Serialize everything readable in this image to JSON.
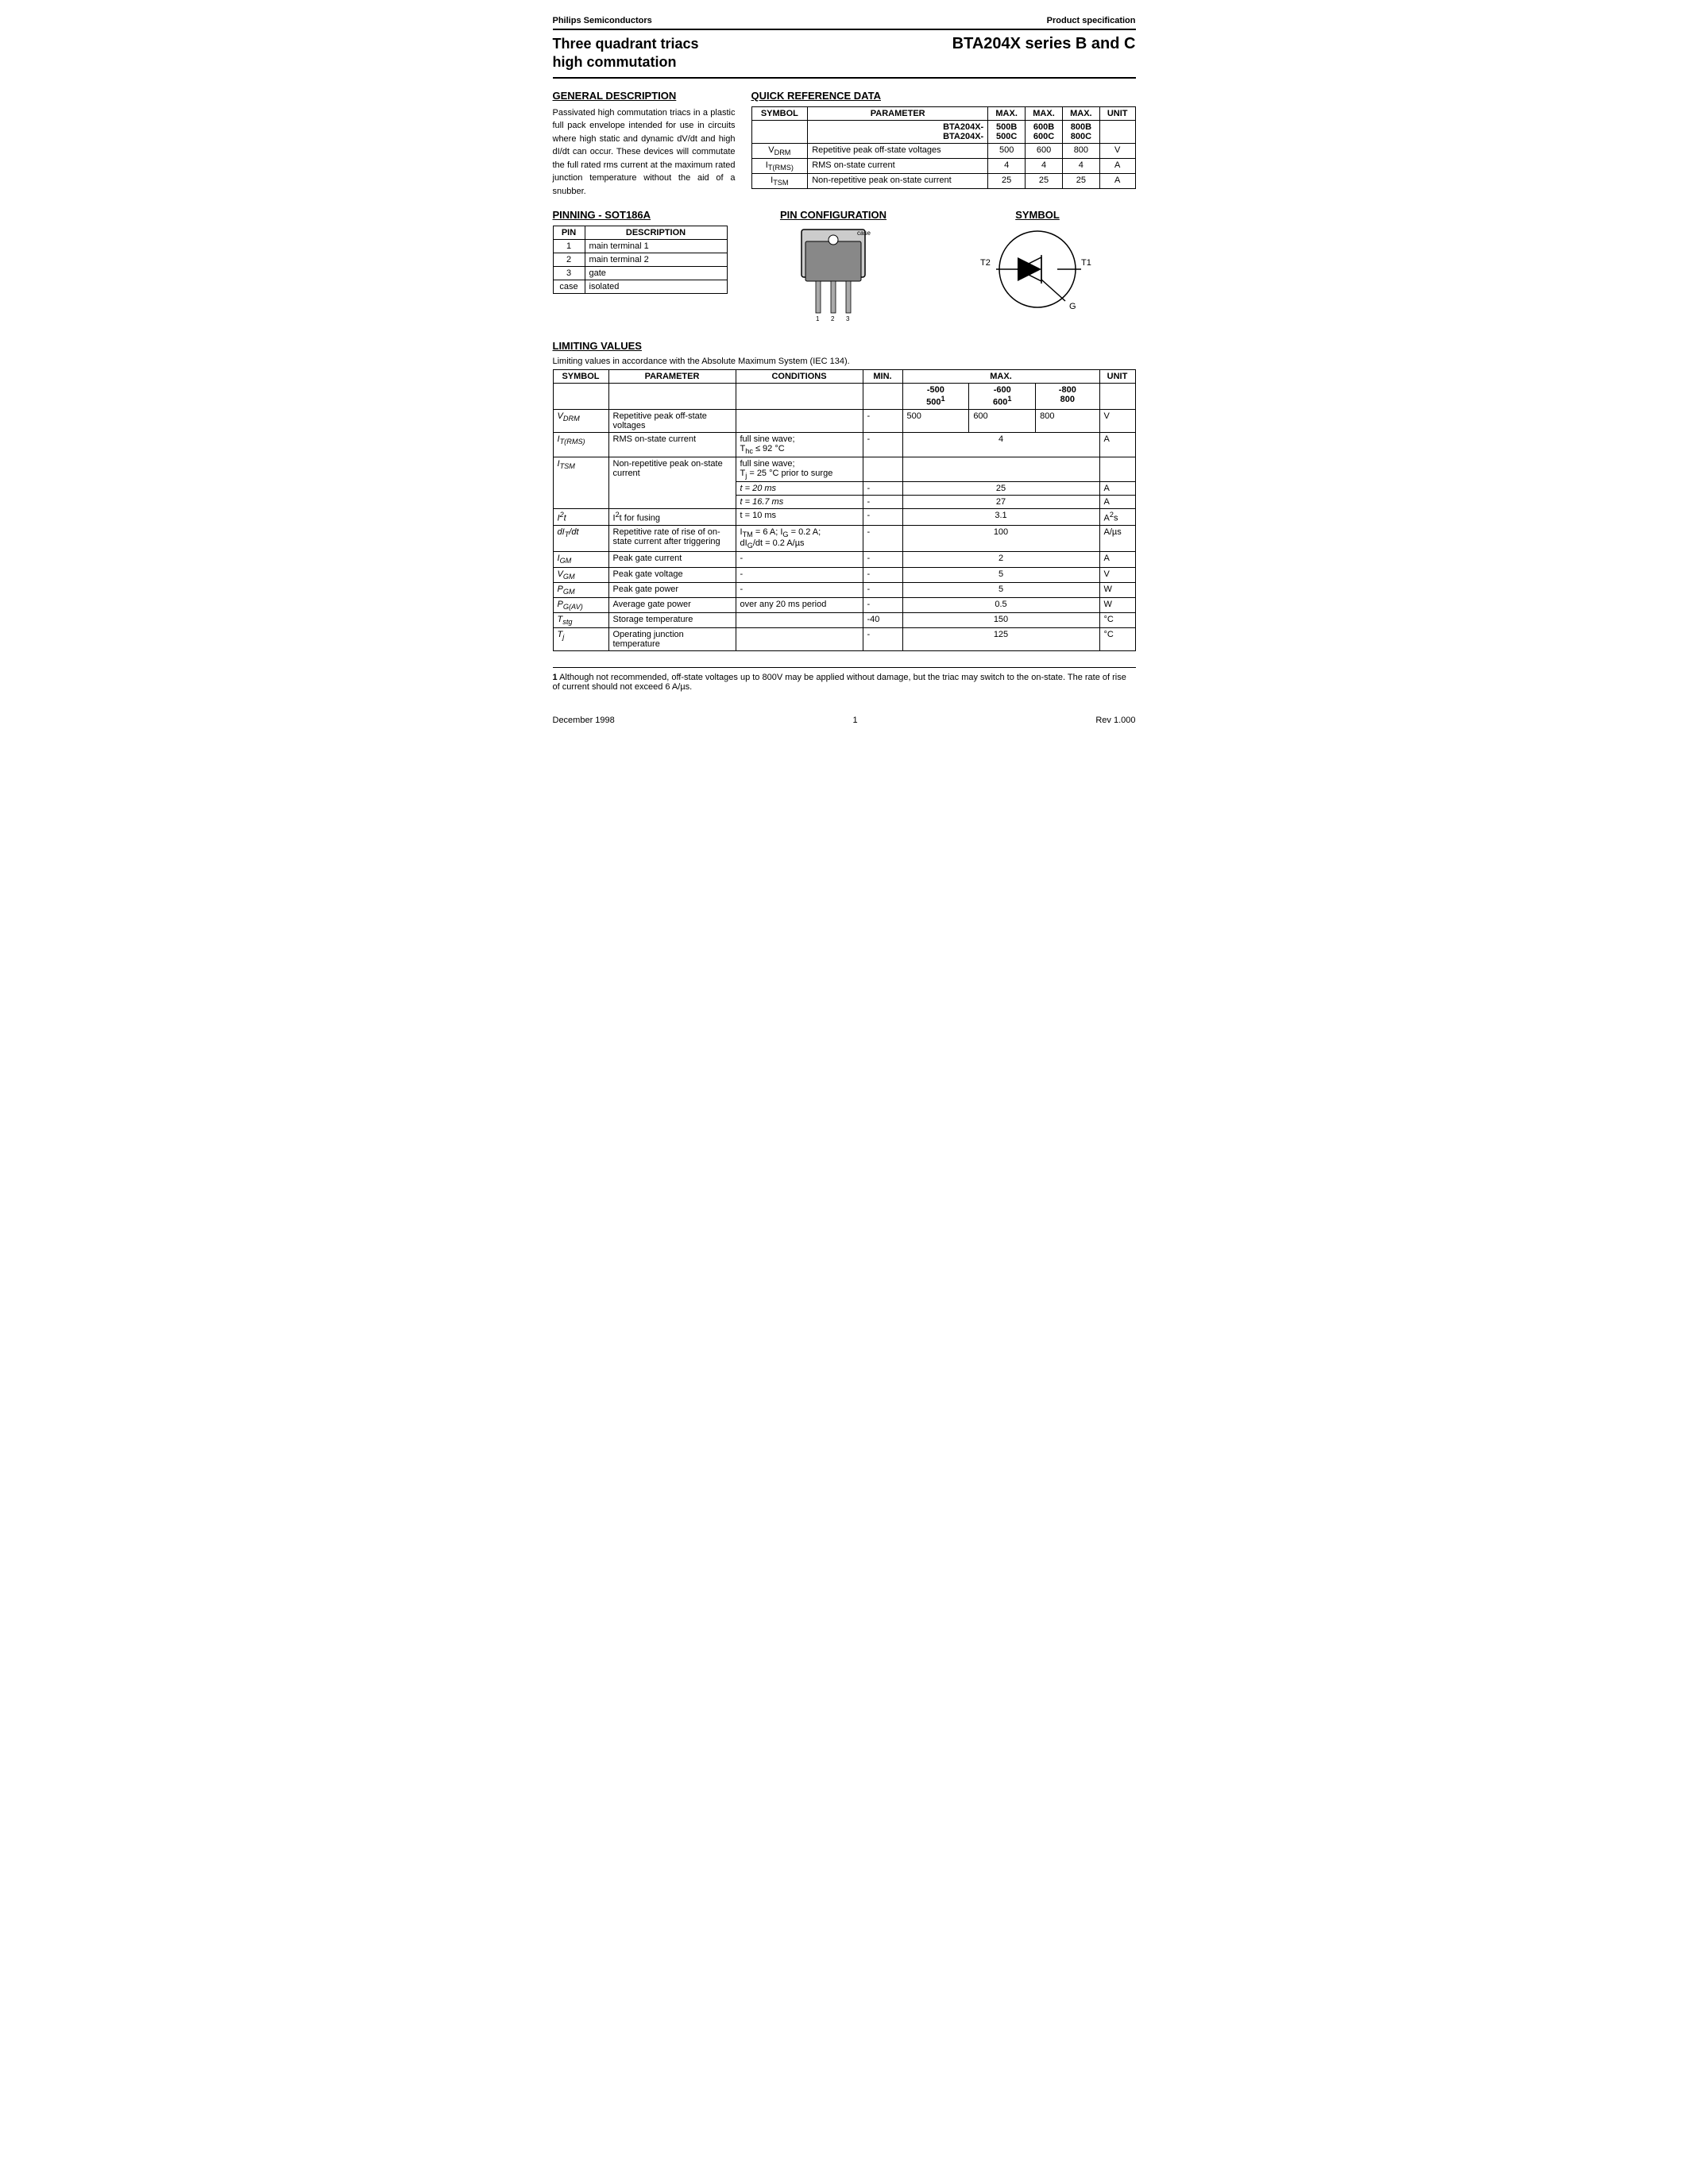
{
  "header": {
    "company": "Philips Semiconductors",
    "doc_type": "Product specification"
  },
  "title": {
    "left_line1": "Three quadrant triacs",
    "left_line2": "high commutation",
    "right": "BTA204X series  B and C"
  },
  "general_description": {
    "heading": "GENERAL DESCRIPTION",
    "text": "Passivated high commutation triacs in a plastic full pack envelope intended for use in circuits where high static and dynamic dV/dt and high dI/dt can occur. These devices will commutate the full rated rms current at the maximum rated junction temperature without the aid of a snubber."
  },
  "quick_reference": {
    "heading": "QUICK REFERENCE DATA",
    "columns": [
      "SYMBOL",
      "PARAMETER",
      "MAX.",
      "MAX.",
      "MAX.",
      "UNIT"
    ],
    "subheader": [
      "",
      "BTA204X-\nBTA204X-",
      "500B\n500C",
      "600B\n600C",
      "800B\n800C",
      ""
    ],
    "rows": [
      {
        "symbol": "V_DRM",
        "parameter": "Repetitive peak off-state voltages",
        "v500": "500",
        "v600": "600",
        "v800": "800",
        "unit": "V"
      },
      {
        "symbol": "I_T(RMS)",
        "parameter": "RMS on-state current",
        "v500": "4",
        "v600": "4",
        "v800": "4",
        "unit": "A"
      },
      {
        "symbol": "I_TSM",
        "parameter": "Non-repetitive peak on-state current",
        "v500": "25",
        "v600": "25",
        "v800": "25",
        "unit": "A"
      }
    ]
  },
  "pinning": {
    "heading": "PINNING - SOT186A",
    "columns": [
      "PIN",
      "DESCRIPTION"
    ],
    "rows": [
      {
        "pin": "1",
        "desc": "main terminal 1"
      },
      {
        "pin": "2",
        "desc": "main terminal 2"
      },
      {
        "pin": "3",
        "desc": "gate"
      },
      {
        "pin": "case",
        "desc": "isolated"
      }
    ]
  },
  "pin_config": {
    "heading": "PIN CONFIGURATION"
  },
  "symbol_section": {
    "heading": "SYMBOL",
    "t2_label": "T2",
    "t1_label": "T1",
    "g_label": "G"
  },
  "limiting_values": {
    "heading": "LIMITING VALUES",
    "note": "Limiting values in accordance with the Absolute Maximum System (IEC 134).",
    "columns": [
      "SYMBOL",
      "PARAMETER",
      "CONDITIONS",
      "MIN.",
      "MAX.",
      "UNIT"
    ],
    "max_sub": [
      "-500\n500¹",
      "-600\n600¹",
      "-800\n800"
    ],
    "rows": [
      {
        "symbol": "V_DRM",
        "parameter": "Repetitive peak off-state voltages",
        "conditions": "",
        "min": "-",
        "max": "-500 / 500¹  -600 / 600¹  -800 / 800",
        "unit": "V",
        "rowspan": 1
      },
      {
        "symbol": "I_T(RMS)",
        "parameter": "RMS on-state current",
        "conditions": "full sine wave; T_hc ≤ 92 °C",
        "min": "-",
        "max": "4",
        "unit": "A"
      },
      {
        "symbol": "I_TSM",
        "parameter": "Non-repetitive peak on-state current",
        "conditions": "full sine wave; T_j = 25 °C prior to surge",
        "min": "",
        "max": "",
        "unit": ""
      },
      {
        "symbol": "",
        "parameter": "",
        "conditions": "t = 20 ms",
        "min": "-",
        "max": "25",
        "unit": "A"
      },
      {
        "symbol": "",
        "parameter": "",
        "conditions": "t = 16.7 ms",
        "min": "-",
        "max": "27",
        "unit": "A"
      },
      {
        "symbol": "I²t",
        "parameter": "I²t for fusing",
        "conditions": "t = 10 ms",
        "min": "-",
        "max": "3.1",
        "unit": "A²s"
      },
      {
        "symbol": "dI_T/dt",
        "parameter": "Repetitive rate of rise of on-state current after triggering",
        "conditions": "I_TM = 6 A; I_G = 0.2 A; dI_G/dt = 0.2 A/µs",
        "min": "-",
        "max": "100",
        "unit": "A/µs"
      },
      {
        "symbol": "I_GM",
        "parameter": "Peak gate current",
        "conditions": "-",
        "min": "-",
        "max": "2",
        "unit": "A"
      },
      {
        "symbol": "V_GM",
        "parameter": "Peak gate voltage",
        "conditions": "-",
        "min": "-",
        "max": "5",
        "unit": "V"
      },
      {
        "symbol": "P_GM",
        "parameter": "Peak gate power",
        "conditions": "-",
        "min": "-",
        "max": "5",
        "unit": "W"
      },
      {
        "symbol": "P_G(AV)",
        "parameter": "Average gate power",
        "conditions": "over any 20 ms period",
        "min": "-",
        "max": "0.5",
        "unit": "W"
      },
      {
        "symbol": "T_stg",
        "parameter": "Storage temperature",
        "conditions": "",
        "min": "-40",
        "max": "150",
        "unit": "°C"
      },
      {
        "symbol": "T_j",
        "parameter": "Operating junction temperature",
        "conditions": "",
        "min": "-",
        "max": "125",
        "unit": "°C"
      }
    ]
  },
  "footnote": {
    "number": "1",
    "text": "Although not recommended, off-state voltages up to 800V may be applied without damage, but the triac may switch to the on-state. The rate of rise of current should not exceed 6 A/µs."
  },
  "footer": {
    "date": "December 1998",
    "page": "1",
    "rev": "Rev 1.000"
  }
}
